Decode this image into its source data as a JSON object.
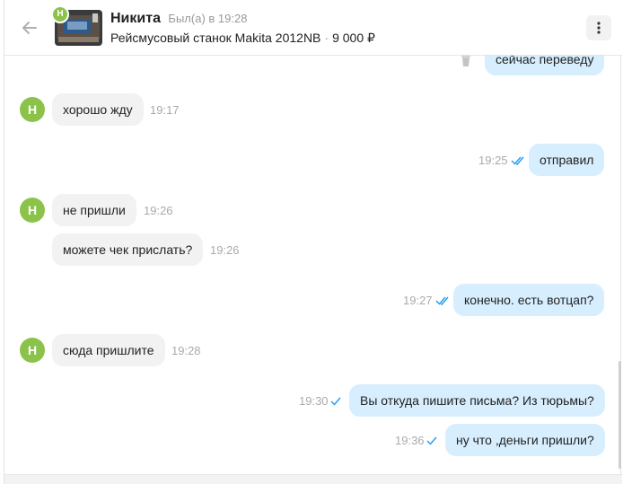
{
  "header": {
    "contact_name": "Никита",
    "status": "Был(а) в 19:28",
    "avatar_letter": "Н",
    "product_title": "Рейсмусовый станок Makita 2012NB",
    "separator": "·",
    "price": "9 000 ₽"
  },
  "messages": [
    {
      "direction": "out",
      "text": "сейчас переведу",
      "time": "",
      "status": "deleted-option"
    },
    {
      "direction": "in",
      "text": "хорошо жду",
      "time": "19:17",
      "avatar": "Н"
    },
    {
      "direction": "out",
      "text": "отправил",
      "time": "19:25",
      "status": "read"
    },
    {
      "direction": "in",
      "text": "не пришли",
      "time": "19:26",
      "avatar": "Н"
    },
    {
      "direction": "in",
      "text": "можете чек прислать?",
      "time": "19:26"
    },
    {
      "direction": "out",
      "text": "конечно. есть вотцап?",
      "time": "19:27",
      "status": "read"
    },
    {
      "direction": "in",
      "text": "сюда пришлите",
      "time": "19:28",
      "avatar": "Н"
    },
    {
      "direction": "out",
      "text": "Вы откуда пишите письма? Из тюрьмы?",
      "time": "19:30",
      "status": "sent"
    },
    {
      "direction": "out",
      "text": "ну что ,деньги пришли?",
      "time": "19:36",
      "status": "sent"
    }
  ],
  "colors": {
    "avatar": "#8bc34a",
    "incoming_bubble": "#f2f2f2",
    "outgoing_bubble": "#d6eefe",
    "check": "#1e9bf0",
    "time": "#aaaaaa"
  },
  "icons": {
    "back": "arrow-left-icon",
    "menu": "more-vertical-icon",
    "trash": "trash-icon",
    "check_single": "check-icon",
    "check_double": "double-check-icon"
  }
}
